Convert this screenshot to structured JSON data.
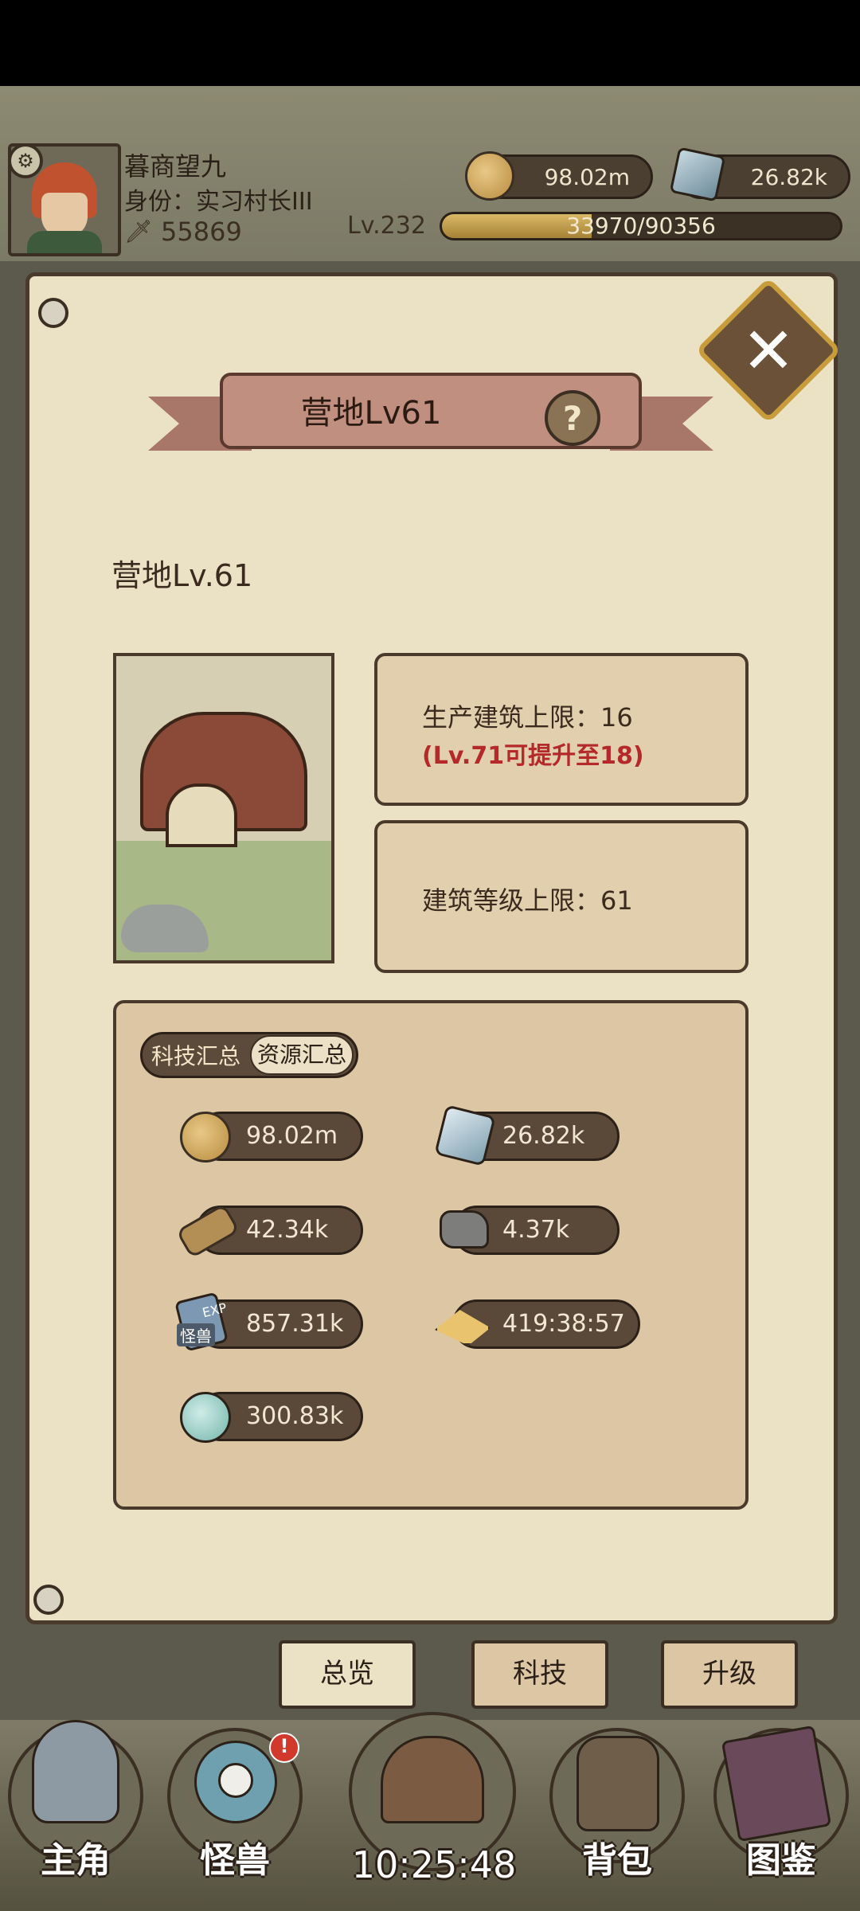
{
  "player": {
    "name": "暮商望九",
    "title": "身份：实习村长III",
    "power": "55869",
    "level_label": "Lv.232",
    "xp": "33970/90356",
    "xp_progress": 0.376
  },
  "currency": {
    "coins": "98.02m",
    "gems": "26.82k"
  },
  "dialog": {
    "title": "营地Lv61",
    "help_icon": "?",
    "level_text": "营地Lv.61",
    "stat1": "生产建筑上限：16",
    "stat1_note": "(Lv.71可提升至18)",
    "stat2": "建筑等级上限：61"
  },
  "summary": {
    "tab_tech": "科技汇总",
    "tab_resource": "资源汇总",
    "resources": [
      {
        "icon": "coin-icon",
        "value": "98.02m"
      },
      {
        "icon": "gem-icon",
        "value": "26.82k"
      },
      {
        "icon": "wood-icon",
        "value": "42.34k"
      },
      {
        "icon": "ore-icon",
        "value": "4.37k"
      },
      {
        "icon": "exp-card-icon",
        "value": "857.31k"
      },
      {
        "icon": "map-icon",
        "value": "419:38:57"
      },
      {
        "icon": "water-drop-icon",
        "value": "300.83k"
      }
    ],
    "exp_tag_top": "EXP",
    "exp_tag_bottom": "怪兽"
  },
  "tabs": {
    "overview": "总览",
    "tech": "科技",
    "upgrade": "升级"
  },
  "nav": {
    "hero": "主角",
    "monster": "怪兽",
    "bag": "背包",
    "codex": "图鉴",
    "monster_badge": "!",
    "time": "10:25:48"
  },
  "colors": {
    "paper": "#ebe1c5",
    "ribbon": "#c08f80",
    "warning_text": "#b5292b",
    "close_border": "#c99c3b"
  }
}
